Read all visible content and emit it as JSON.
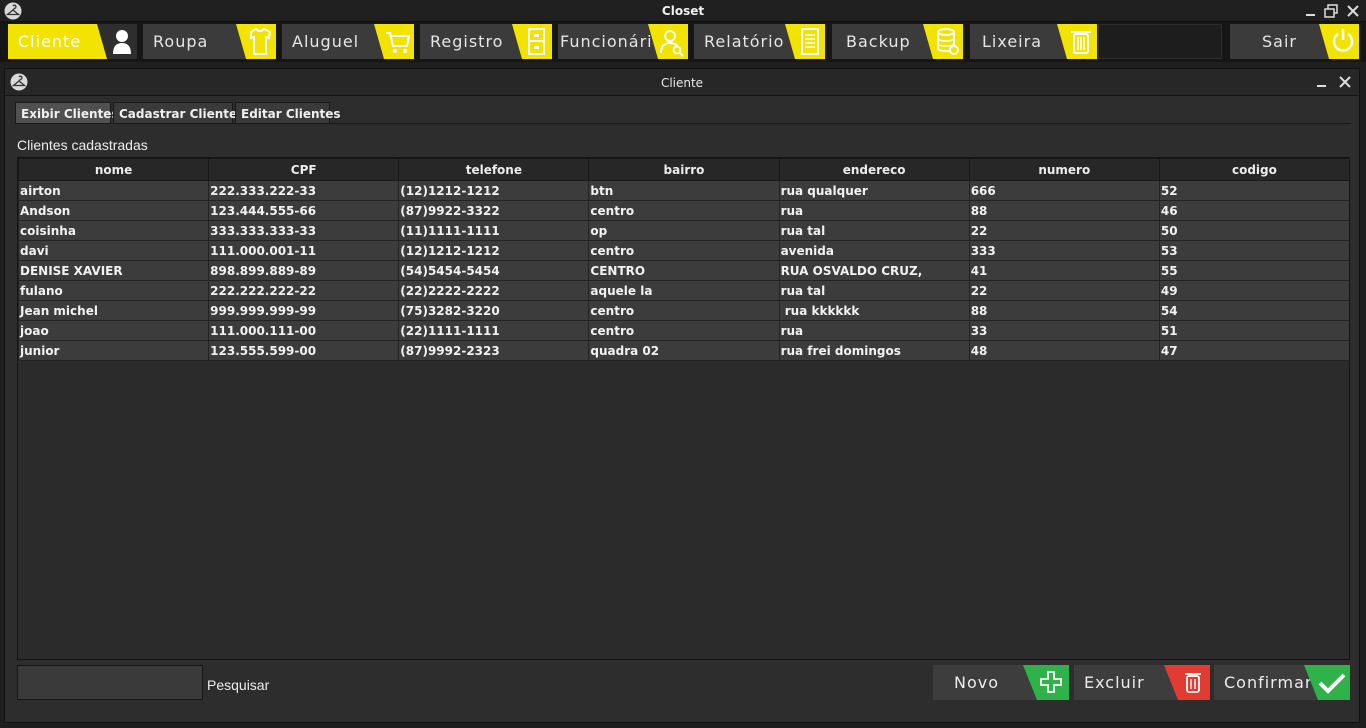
{
  "window": {
    "title": "Closet"
  },
  "menu": {
    "items": [
      {
        "label": "Cliente",
        "icon": "user-icon"
      },
      {
        "label": "Roupa",
        "icon": "shirt-icon"
      },
      {
        "label": "Aluguel",
        "icon": "cart-icon"
      },
      {
        "label": "Registro",
        "icon": "cabinet-icon"
      },
      {
        "label": "Funcionário",
        "icon": "employee-icon"
      },
      {
        "label": "Relatório",
        "icon": "report-icon"
      },
      {
        "label": "Backup",
        "icon": "database-icon"
      },
      {
        "label": "Lixeira",
        "icon": "trash-icon"
      }
    ],
    "exit_label": "Sair",
    "accent": "#f2e300"
  },
  "frame": {
    "title": "Cliente",
    "tabs": [
      "Exibir Clientes",
      "Cadastrar Clientes",
      "Editar Clientes"
    ],
    "section_label": "Clientes cadastradas"
  },
  "table": {
    "columns": [
      "nome",
      "CPF",
      "telefone",
      "bairro",
      "endereco",
      "numero",
      "codigo"
    ],
    "rows": [
      [
        "airton",
        "222.333.222-33",
        "(12)1212-1212",
        "btn",
        "rua qualquer",
        "666",
        "52"
      ],
      [
        "Andson",
        "123.444.555-66",
        "(87)9922-3322",
        "centro",
        "rua",
        "88",
        "46"
      ],
      [
        "coisinha",
        "333.333.333-33",
        "(11)1111-1111",
        "op",
        "rua tal",
        "22",
        "50"
      ],
      [
        "davi",
        "111.000.001-11",
        "(12)1212-1212",
        "centro",
        "avenida",
        "333",
        "53"
      ],
      [
        "DENISE XAVIER",
        "898.899.889-89",
        "(54)5454-5454",
        "CENTRO",
        "RUA OSVALDO CRUZ,",
        "41",
        "55"
      ],
      [
        "fulano",
        "222.222.222-22",
        "(22)2222-2222",
        "aquele la",
        "rua tal",
        "22",
        "49"
      ],
      [
        "Jean michel",
        "999.999.999-99",
        "(75)3282-3220",
        "centro",
        " rua kkkkkk",
        "88",
        "54"
      ],
      [
        "joao",
        "111.000.111-00",
        "(22)1111-1111",
        "centro",
        "rua",
        "33",
        "51"
      ],
      [
        "junior",
        "123.555.599-00",
        "(87)9992-2323",
        "quadra 02",
        "rua frei domingos",
        "48",
        "47"
      ]
    ]
  },
  "search": {
    "value": "",
    "label": "Pesquisar"
  },
  "actions": {
    "novo": {
      "label": "Novo",
      "color": "#2fb24a"
    },
    "excluir": {
      "label": "Excluir",
      "color": "#e23b32"
    },
    "confirmar": {
      "label": "Confirmar",
      "color": "#2fb24a"
    }
  }
}
